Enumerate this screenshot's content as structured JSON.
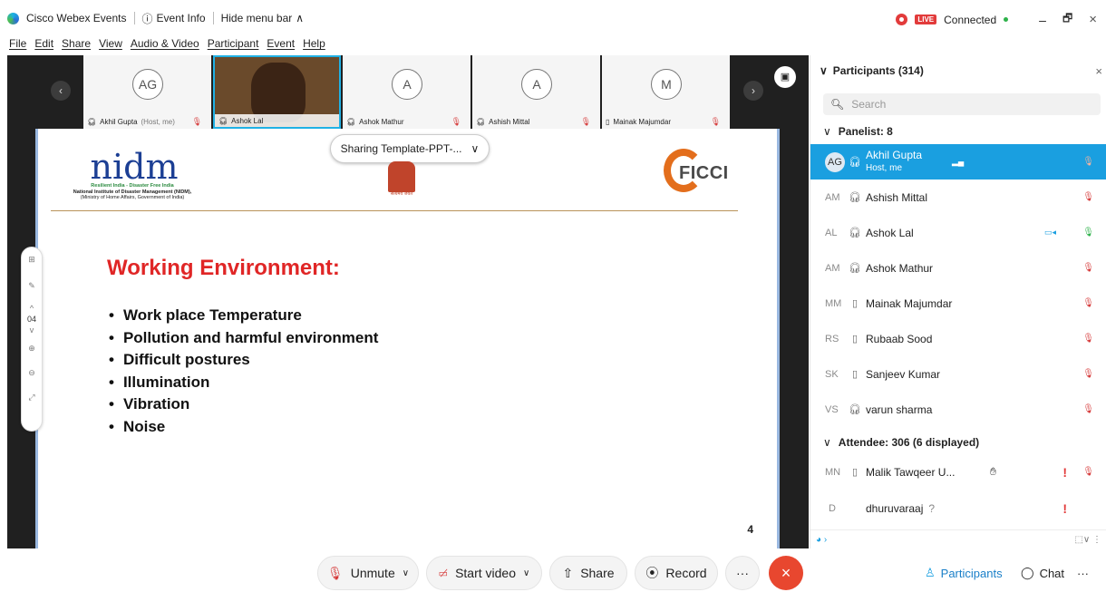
{
  "titlebar": {
    "app_name": "Cisco Webex Events",
    "event_info": "Event Info",
    "hide_menu": "Hide menu bar",
    "live": "LIVE",
    "connection": "Connected",
    "minimize": "–",
    "restore": "🗗",
    "close": "×"
  },
  "menu": [
    "File",
    "Edit",
    "Share",
    "View",
    "Audio & Video",
    "Participant",
    "Event",
    "Help"
  ],
  "filmstrip": {
    "tiles": [
      {
        "initials": "AG",
        "name": "Akhil Gupta",
        "note": "(Host, me)"
      },
      {
        "initials": "",
        "name": "Ashok Lal",
        "note": ""
      },
      {
        "initials": "A",
        "name": "Ashok Mathur",
        "note": ""
      },
      {
        "initials": "A",
        "name": "Ashish Mittal",
        "note": ""
      },
      {
        "initials": "M",
        "name": "Mainak Majumdar",
        "note": ""
      }
    ]
  },
  "share_menu": {
    "label": "Sharing Template-PPT-..."
  },
  "slide": {
    "logo_left": "nidm",
    "logo_left_tagline": "Resilient India - Disaster Free India",
    "logo_left_org": "National Institute of Disaster Management (NIDM),",
    "logo_left_ministry": "(Ministry of Home Affairs, Government of India)",
    "emblem_caption": "सत्यमेव जयते",
    "logo_right": "FICCI",
    "title": "Working Environment:",
    "bullets": [
      "Work place Temperature",
      "Pollution and harmful environment",
      "Difficult postures",
      "Illumination",
      "Vibration",
      "Noise"
    ],
    "page_number": "4",
    "current_page": "04"
  },
  "controls": {
    "unmute": "Unmute",
    "start_video": "Start video",
    "share": "Share",
    "record": "Record",
    "more": "···",
    "end": "×",
    "participants": "Participants",
    "chat": "Chat"
  },
  "panel": {
    "title": "Participants (314)",
    "search_placeholder": "Search",
    "panelist_header": "Panelist: 8",
    "panelists": [
      {
        "initials": "AG",
        "name": "Akhil Gupta",
        "sub": "Host, me",
        "device": "headset",
        "muted": true,
        "selected": true
      },
      {
        "initials": "AM",
        "name": "Ashish Mittal",
        "device": "headset",
        "muted": true
      },
      {
        "initials": "AL",
        "name": "Ashok Lal",
        "device": "headset",
        "muted": false,
        "video": true
      },
      {
        "initials": "AM",
        "name": "Ashok Mathur",
        "device": "headset",
        "muted": true
      },
      {
        "initials": "MM",
        "name": "Mainak Majumdar",
        "device": "mobile",
        "muted": true
      },
      {
        "initials": "RS",
        "name": "Rubaab Sood",
        "device": "mobile",
        "muted": true
      },
      {
        "initials": "SK",
        "name": "Sanjeev Kumar",
        "device": "mobile",
        "muted": true
      },
      {
        "initials": "VS",
        "name": "varun sharma",
        "device": "headset",
        "muted": true
      }
    ],
    "attendee_header": "Attendee: 306 (6 displayed)",
    "attendees": [
      {
        "initials": "MN",
        "name": "Malik Tawqeer U...",
        "device": "mobile",
        "raised_hand": true,
        "alert": "!",
        "muted": true
      },
      {
        "initials": "D",
        "name": "dhuruvaraaj",
        "device": "",
        "status": "?",
        "alert": "!"
      }
    ]
  },
  "colors": {
    "accent": "#1a9fe0",
    "mute": "#d63b3b",
    "live": "#e23b3b",
    "slide_title": "#e02626",
    "end_call": "#e8472f"
  }
}
